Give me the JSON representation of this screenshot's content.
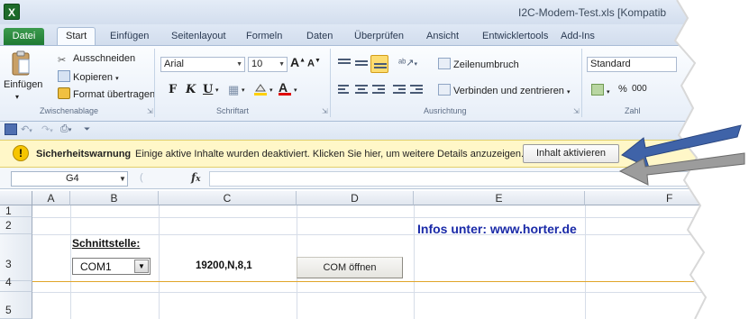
{
  "window": {
    "title": "I2C-Modem-Test.xls [Kompatib",
    "app_icon": "excel-icon"
  },
  "tabs": {
    "file": "Datei",
    "items": [
      "Start",
      "Einfügen",
      "Seitenlayout",
      "Formeln",
      "Daten",
      "Überprüfen",
      "Ansicht",
      "Entwicklertools",
      "Add-Ins"
    ]
  },
  "ribbon": {
    "clipboard": {
      "paste": "Einfügen",
      "cut": "Ausschneiden",
      "copy": "Kopieren",
      "format_painter": "Format übertragen",
      "label": "Zwischenablage"
    },
    "font": {
      "name": "Arial",
      "size": "10",
      "grow": "A",
      "shrink": "A",
      "bold": "F",
      "italic": "K",
      "underline": "U",
      "label": "Schriftart"
    },
    "alignment": {
      "wrap": "Zeilenumbruch",
      "merge": "Verbinden und zentrieren",
      "label": "Ausrichtung"
    },
    "number": {
      "format": "Standard",
      "percent": "%",
      "thousands": "000",
      "label": "Zahl"
    }
  },
  "security_bar": {
    "title": "Sicherheitswarnung",
    "message": "Einige aktive Inhalte wurden deaktiviert. Klicken Sie hier, um weitere Details anzuzeigen.",
    "button": "Inhalt aktivieren"
  },
  "formula_bar": {
    "name_box": "G4",
    "fx": "fx",
    "formula": ""
  },
  "grid": {
    "columns": [
      "A",
      "B",
      "C",
      "D",
      "E",
      "F"
    ],
    "rows": [
      "1",
      "2",
      "3",
      "4",
      "5"
    ],
    "infos": "Infos unter: www.horter.de",
    "interface_label": "Schnittstelle:",
    "com_port": "COM1",
    "serial_settings": "19200,N,8,1",
    "open_button": "COM öffnen"
  },
  "colors": {
    "accent": "#2b579a",
    "file_tab": "#2a8a3e",
    "warning_bar": "#fff7c8",
    "link_text": "#1a2aa8"
  }
}
